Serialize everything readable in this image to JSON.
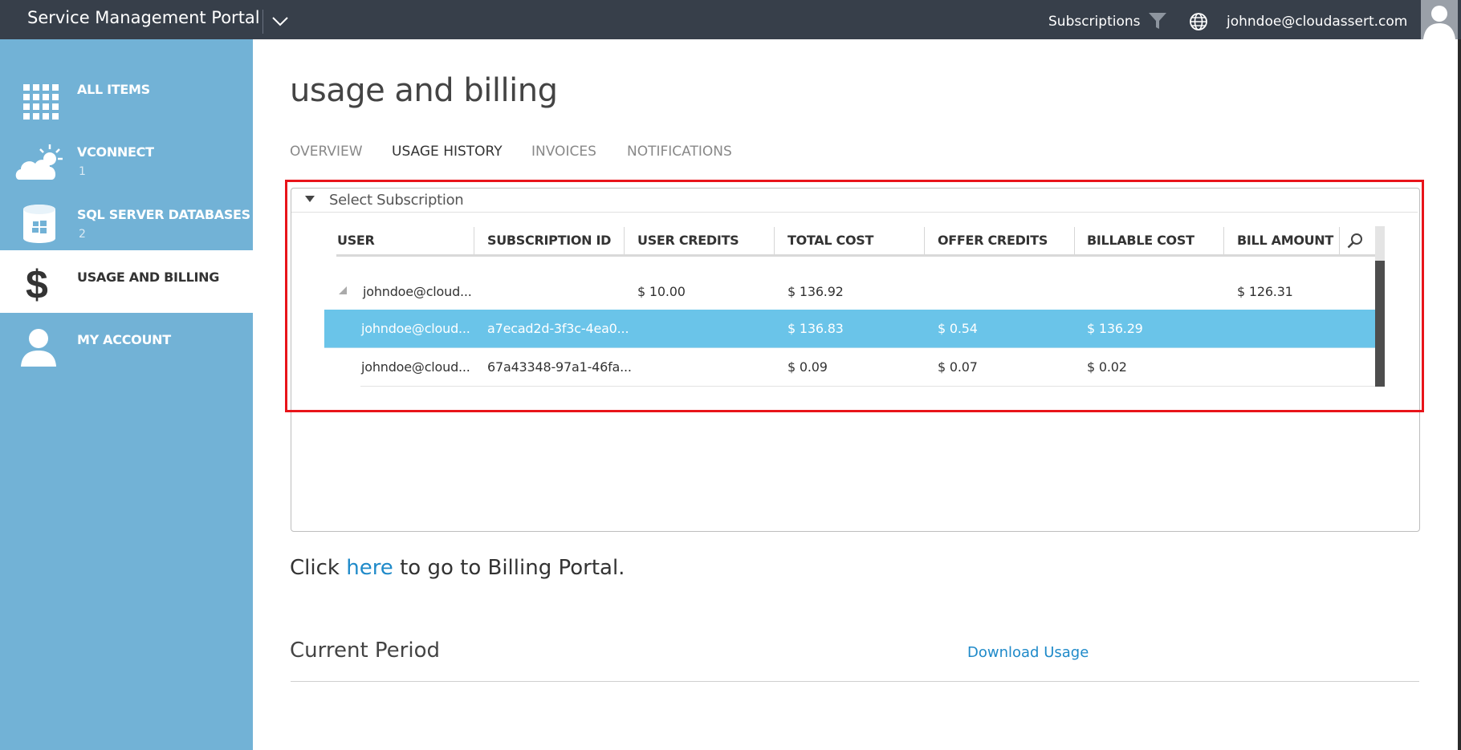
{
  "topbar": {
    "title": "Service Management Portal",
    "subscriptions_label": "Subscriptions",
    "user_email": "johndoe@cloudassert.com"
  },
  "sidebar": {
    "items": [
      {
        "label": "ALL ITEMS",
        "count": "",
        "icon": "grid-icon"
      },
      {
        "label": "VCONNECT",
        "count": "1",
        "icon": "cloud-sun-icon"
      },
      {
        "label": "SQL SERVER DATABASES",
        "count": "2",
        "icon": "database-icon"
      },
      {
        "label": "USAGE AND BILLING",
        "count": "",
        "icon": "dollar-icon",
        "active": true
      },
      {
        "label": "MY ACCOUNT",
        "count": "",
        "icon": "user-icon"
      }
    ]
  },
  "main": {
    "title": "usage and billing",
    "tabs": [
      {
        "label": "OVERVIEW"
      },
      {
        "label": "USAGE HISTORY",
        "active": true
      },
      {
        "label": "INVOICES"
      },
      {
        "label": "NOTIFICATIONS"
      }
    ],
    "select_subscription": "Select Subscription",
    "table": {
      "columns": [
        "USER",
        "SUBSCRIPTION ID",
        "USER CREDITS",
        "TOTAL COST",
        "OFFER CREDITS",
        "BILLABLE COST",
        "BILL AMOUNT"
      ],
      "rows": [
        {
          "user": "johndoe@cloud...",
          "subscription_id": "",
          "user_credits": "$ 10.00",
          "total_cost": "$ 136.92",
          "offer_credits": "",
          "billable_cost": "",
          "bill_amount": "$ 126.31"
        },
        {
          "user": "johndoe@cloud...",
          "subscription_id": "a7ecad2d-3f3c-4ea0...",
          "user_credits": "",
          "total_cost": "$ 136.83",
          "offer_credits": "$ 0.54",
          "billable_cost": "$ 136.29",
          "bill_amount": ""
        },
        {
          "user": "johndoe@cloud...",
          "subscription_id": "67a43348-97a1-46fa...",
          "user_credits": "",
          "total_cost": "$ 0.09",
          "offer_credits": "$ 0.07",
          "billable_cost": "$ 0.02",
          "bill_amount": ""
        }
      ]
    },
    "billing_portal": {
      "prefix": "Click ",
      "link": "here",
      "suffix": " to go to Billing Portal."
    },
    "current_period_label": "Current Period",
    "download_usage_label": "Download Usage"
  },
  "colors": {
    "topbar": "#373f4a",
    "sidebar": "#72b2d6",
    "selected_row": "#6ac4e9",
    "highlight_frame": "#e8141a",
    "link": "#1f8ac9"
  }
}
